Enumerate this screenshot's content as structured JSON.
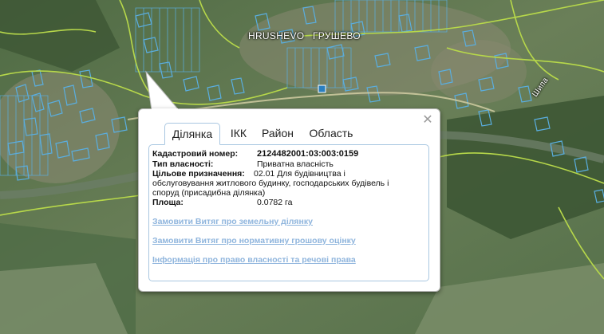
{
  "map": {
    "place_label_1": "HRUSHEVO",
    "place_label_2": "ГРУШЕВО",
    "road_label": "Шипа",
    "colors": {
      "parcel": "#5aaee0",
      "road": "#b7d84a",
      "terrain_dark": "#3f5a3a",
      "terrain_light": "#6f8a5c"
    }
  },
  "popup": {
    "close_icon": "close-icon",
    "tabs": [
      {
        "label": "Ділянка",
        "active": true
      },
      {
        "label": "ІКК",
        "active": false
      },
      {
        "label": "Район",
        "active": false
      },
      {
        "label": "Область",
        "active": false
      }
    ],
    "fields": {
      "cadastral_label": "Кадастровий номер:",
      "cadastral_value": "2124482001:03:003:0159",
      "ownership_label": "Тип власності:",
      "ownership_value": "Приватна власність",
      "purpose_label": "Цільове призначення:",
      "purpose_value_1": "02.01 Для будівництва і",
      "purpose_value_2": "обслуговування житлового будинку, господарських будівель і",
      "purpose_value_3": "споруд (присадибна ділянка)",
      "area_label": "Площа:",
      "area_value": "0.0782 га"
    },
    "links": [
      "Замовити Витяг про земельну ділянку",
      "Замовити Витяг про нормативну грошову оцінку",
      "Інформація про право власності та речові права"
    ]
  }
}
